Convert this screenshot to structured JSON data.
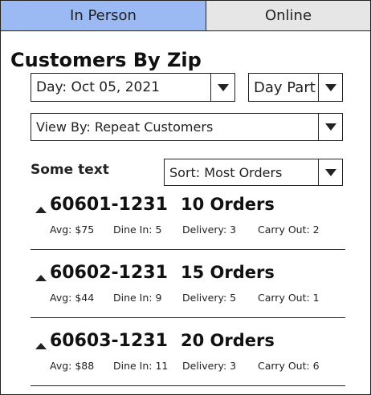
{
  "tabs": {
    "in_person": "In Person",
    "online": "Online"
  },
  "colors": {
    "active_tab": "#9bb9f2",
    "inactive_tab": "#e6e6e6"
  },
  "title": "Customers By Zip",
  "filters": {
    "day": "Day: Oct 05, 2021",
    "day_part": "Day Part",
    "view_by": "View By: Repeat Customers",
    "sort": "Sort: Most Orders"
  },
  "section_label": "Some text",
  "zips": [
    {
      "zip": "60601-1231",
      "orders": "10 Orders",
      "avg": "Avg: $75",
      "dine_in": "Dine In: 5",
      "delivery": "Delivery: 3",
      "carry_out": "Carry Out: 2"
    },
    {
      "zip": "60602-1231",
      "orders": "15 Orders",
      "avg": "Avg: $44",
      "dine_in": "Dine In: 9",
      "delivery": "Delivery: 5",
      "carry_out": "Carry Out: 1"
    },
    {
      "zip": "60603-1231",
      "orders": "20 Orders",
      "avg": "Avg: $88",
      "dine_in": "Dine In: 11",
      "delivery": "Delivery: 3",
      "carry_out": "Carry Out: 6"
    }
  ]
}
